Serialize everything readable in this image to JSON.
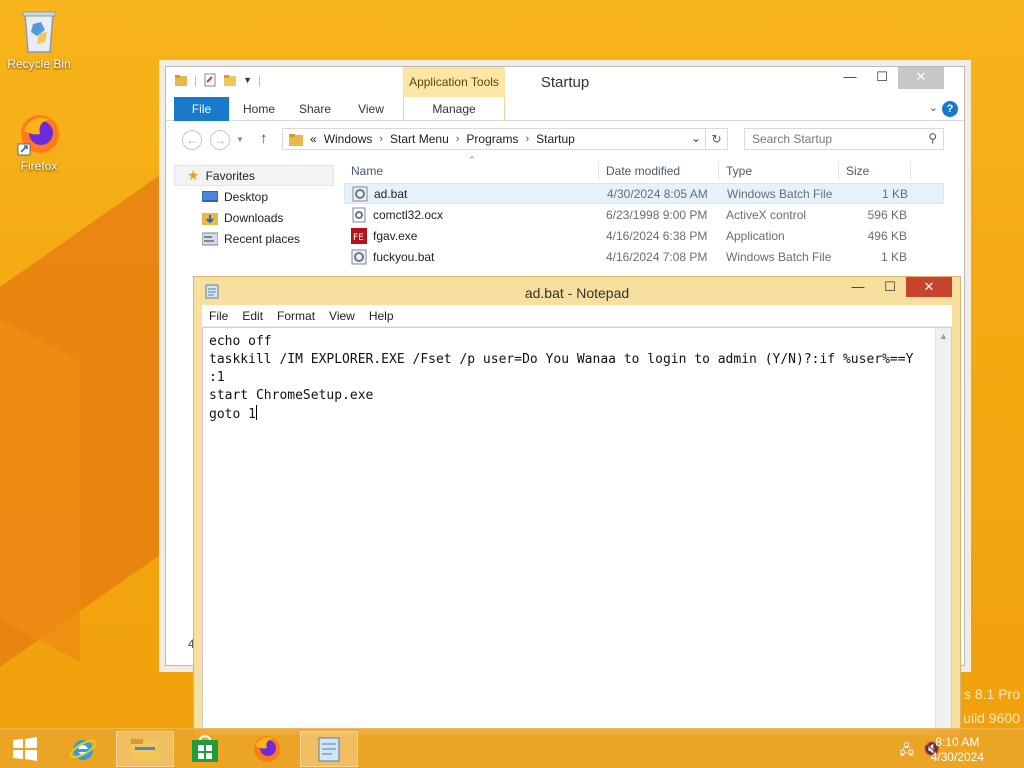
{
  "desktop": {
    "icons": [
      {
        "label": "Recycle Bin"
      },
      {
        "label": "Firefox"
      }
    ],
    "watermark": [
      "s 8.1 Pro",
      "uild 9600"
    ]
  },
  "explorer": {
    "title": "Startup",
    "ribbon": {
      "context_tab": "Application Tools",
      "tabs": [
        "File",
        "Home",
        "Share",
        "View",
        "Manage"
      ]
    },
    "address": {
      "prefix": "«",
      "path": [
        "Windows",
        "Start Menu",
        "Programs",
        "Startup"
      ],
      "search_placeholder": "Search Startup"
    },
    "nav": {
      "favorites": "Favorites",
      "items": [
        "Desktop",
        "Downloads",
        "Recent places"
      ],
      "partial": "4"
    },
    "columns": [
      "Name",
      "Date modified",
      "Type",
      "Size"
    ],
    "files": [
      {
        "name": "ad.bat",
        "date": "4/30/2024 8:05 AM",
        "type": "Windows Batch File",
        "size": "1 KB"
      },
      {
        "name": "comctl32.ocx",
        "date": "6/23/1998 9:00 PM",
        "type": "ActiveX control",
        "size": "596 KB"
      },
      {
        "name": "fgav.exe",
        "date": "4/16/2024 6:38 PM",
        "type": "Application",
        "size": "496 KB"
      },
      {
        "name": "fuckyou.bat",
        "date": "4/16/2024 7:08 PM",
        "type": "Windows Batch File",
        "size": "1 KB"
      }
    ]
  },
  "notepad": {
    "title": "ad.bat - Notepad",
    "menu": [
      "File",
      "Edit",
      "Format",
      "View",
      "Help"
    ],
    "lines": [
      "echo off",
      "taskkill /IM EXPLORER.EXE /Fset /p user=Do You Wanaa to login to admin (Y/N)?:if %user%==Y",
      ":1",
      "start ChromeSetup.exe",
      "goto 1"
    ]
  },
  "taskbar": {
    "time": "8:10 AM",
    "date": "4/30/2024"
  },
  "colors": {
    "desktop": "#f4a911",
    "ribbon_file": "#1979ca",
    "app_tools": "#fbe6a6",
    "close_button": "#c7442e"
  }
}
